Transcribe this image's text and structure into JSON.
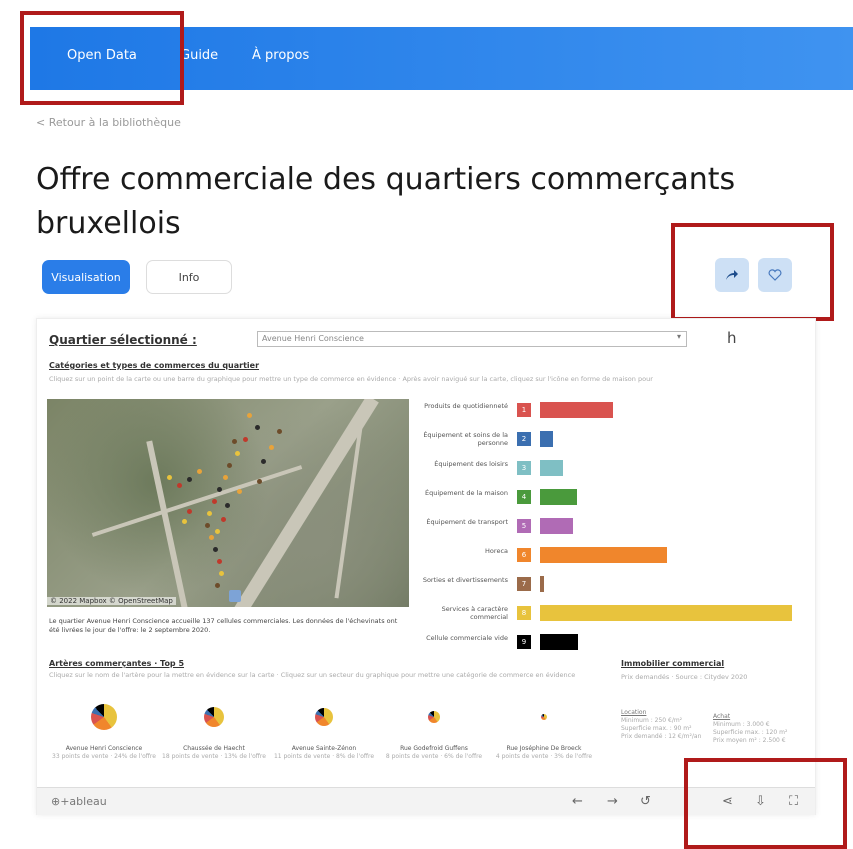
{
  "nav": {
    "items": [
      "Open Data",
      "Guide",
      "À propos"
    ]
  },
  "back_link": "< Retour à la bibliothèque",
  "page_title": "Offre commerciale des quartiers commerçants bruxellois",
  "tabs": [
    "Visualisation",
    "Info"
  ],
  "actions": {
    "share_icon": "share-arrow-icon",
    "favorite_icon": "heart-icon"
  },
  "dashboard": {
    "quartier_label": "Quartier sélectionné :",
    "quartier_value": "Avenue Henri Conscience",
    "logo": "h",
    "subtitle": "Catégories et types de commerces du quartier",
    "subtitle_text": "Cliquez sur un point de la carte ou une barre du graphique pour mettre un type de commerce en évidence · Après avoir navigué sur la carte, cliquez sur l'icône en forme de maison pour",
    "map_copyright": "© 2022 Mapbox © OpenStreetMap",
    "map_text": "Le quartier Avenue Henri Conscience accueille 137 cellules commerciales. Les données de l'échevinats ont été livrées le jour de l'offre: le 2 septembre 2020.",
    "categories": [
      {
        "label": "Produits de quotidienneté",
        "num": "1",
        "color": "#d9534f",
        "value": 38
      },
      {
        "label": "Équipement et soins de la personne",
        "num": "2",
        "color": "#3b6fb0",
        "value": 7
      },
      {
        "label": "Équipement des loisirs",
        "num": "3",
        "color": "#7fbfc4",
        "value": 12
      },
      {
        "label": "Équipement de la maison",
        "num": "4",
        "color": "#4a9a3c",
        "value": 19
      },
      {
        "label": "Équipement de transport",
        "num": "5",
        "color": "#b06bb5",
        "value": 17
      },
      {
        "label": "Horeca",
        "num": "6",
        "color": "#f0862c",
        "value": 66
      },
      {
        "label": "Sorties et divertissements",
        "num": "7",
        "color": "#9b6b4a",
        "value": 2
      },
      {
        "label": "Services à caractère commercial",
        "num": "8",
        "color": "#e8c33d",
        "value": 131
      },
      {
        "label": "Cellule commerciale vide",
        "num": "9",
        "color": "#000000",
        "value": 20
      }
    ],
    "arteries_title": "Artères commerçantes · Top 5",
    "arteries_subtitle": "Cliquez sur le nom de l'artère pour la mettre en évidence sur la carte · Cliquez sur un secteur du graphique pour mettre une catégorie de commerce en évidence",
    "arteries": [
      {
        "name": "Avenue Henri Conscience",
        "sub": "33 points de vente · 24% de l'offre"
      },
      {
        "name": "Chaussée de Haecht",
        "sub": "18 points de vente · 13% de l'offre"
      },
      {
        "name": "Avenue Sainte-Zénon",
        "sub": "11 points de vente · 8% de l'offre"
      },
      {
        "name": "Rue Godefroid Guffens",
        "sub": "8 points de vente · 6% de l'offre"
      },
      {
        "name": "Rue Joséphine De Broeck",
        "sub": "4 points de vente · 3% de l'offre"
      }
    ],
    "immo_title": "Immobilier commercial",
    "immo_sub": "Prix demandés · Source : Citydev 2020",
    "immo_col1": {
      "head": "Location",
      "lines": [
        "Minimum : 250 €/m²",
        "Superficie max. : 90 m²",
        "Prix demandé : 12 €/m²/an"
      ]
    },
    "immo_col2": {
      "head": "Achat",
      "lines": [
        "Minimum : 3.000 €",
        "Superficie max. : 120 m²",
        "Prix moyen m² : 2.500 €"
      ]
    },
    "toolbar_brand": "+ableau",
    "toolbar_icons": [
      "undo-icon",
      "redo-icon",
      "revert-icon",
      "share-icon",
      "download-icon",
      "fullscreen-icon"
    ]
  }
}
